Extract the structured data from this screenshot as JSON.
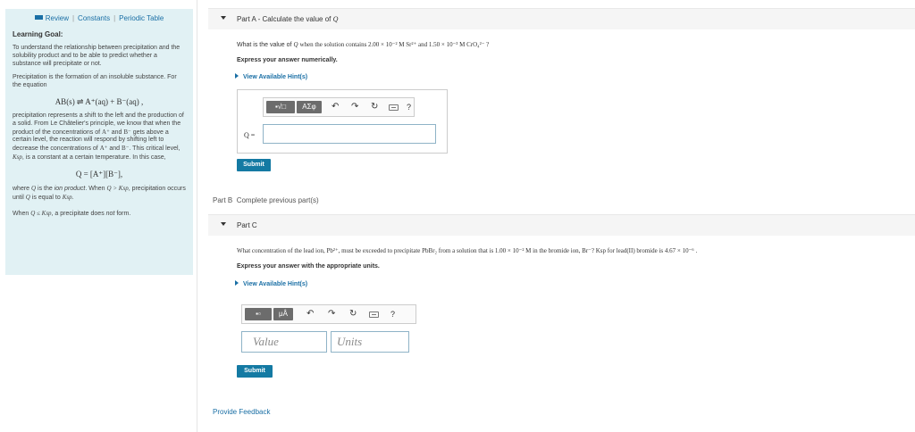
{
  "sidebar": {
    "links": [
      "Review",
      "Constants",
      "Periodic Table"
    ],
    "learning_goal_title": "Learning Goal:",
    "goal_text": "To understand the relationship between precipitation and the solubility product and to be able to predict whether a substance will precipitate or not.",
    "precip_intro": "Precipitation is the formation of an insoluble substance. For the equation",
    "equation1": "AB(s) ⇌ A⁺(aq) + B⁻(aq) ,",
    "shift_text_1": "precipitation represents a shift to the left and the production of a solid. From Le Châtelier's principle, we know that when the product of the concentrations of",
    "shift_ion_a": "A⁺",
    "shift_and": "and",
    "shift_ion_b": "B⁻",
    "shift_text_2": "gets above a certain level, the reaction will respond by shifting left to decrease the concentrations of",
    "shift_ion_a2": "A⁺",
    "shift_and2": "and",
    "shift_ion_b2": "B⁻",
    "shift_text_3": ". This critical level,",
    "ksp": "Ksp",
    "shift_text_4": ", is a constant at a certain temperature. In this case,",
    "equation2": "Q = [A⁺][B⁻],",
    "where_text_1": "where",
    "q_sym": "Q",
    "where_text_2": "is the",
    "ion_product": "ion product",
    "where_text_3": ". When",
    "where_cond": "Q > Ksp",
    "where_text_4": ", precipitation occurs until",
    "where_text_5": "is equal to",
    "ksp2": "Ksp.",
    "when_text_1": "When",
    "when_cond": "Q ≤ Ksp",
    "when_text_2": ", a precipitate does",
    "when_not": "not",
    "when_text_3": "form."
  },
  "partA": {
    "title": "Part A - Calculate the value of",
    "title_sym": "Q",
    "question_1": "What is the value of",
    "question_sym": "Q",
    "question_2": "when the solution contains 2.00 × 10⁻² M Sr²⁺ and 1.50 × 10⁻³ M CrO₄²⁻ ?",
    "instruction": "Express your answer numerically.",
    "hint": "View Available Hint(s)",
    "toolbar_btn1": "▪√□",
    "toolbar_btn2": "ΑΣφ",
    "input_label": "Q =",
    "submit": "Submit"
  },
  "partB": {
    "label": "Part B",
    "status": "Complete previous part(s)"
  },
  "partC": {
    "title": "Part C",
    "question": "What concentration of the lead ion, Pb²⁺, must be exceeded to precipitate PbBr₂ from a solution that is 1.00 × 10⁻² M in the bromide ion, Br⁻? Ksp for lead(II) bromide is 4.67 × 10⁻⁶ .",
    "instruction": "Express your answer with the appropriate units.",
    "hint": "View Available Hint(s)",
    "toolbar_btn1": "▪▫",
    "toolbar_btn2": "μÅ",
    "value_placeholder": "Value",
    "units_placeholder": "Units",
    "submit": "Submit"
  },
  "feedback": "Provide Feedback",
  "colors": {
    "accent": "#147aa3",
    "link": "#1a6fa5",
    "sidebar_bg": "#e1f1f4"
  }
}
